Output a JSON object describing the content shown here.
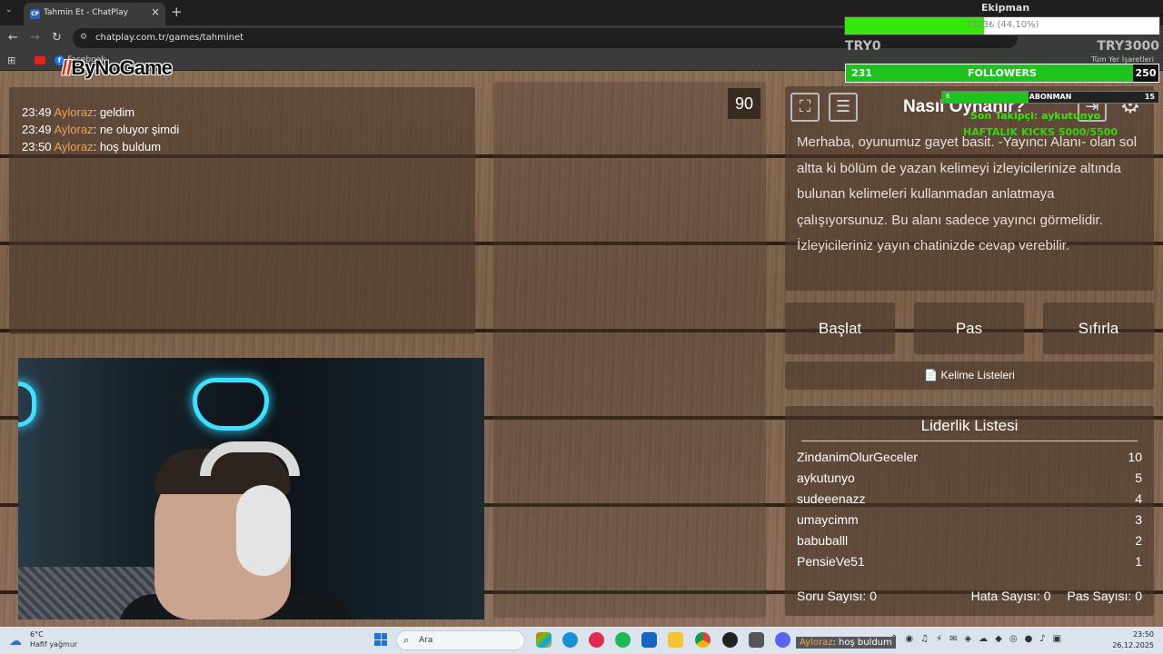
{
  "browser": {
    "tab_title": "Tahmin Et - ChatPlay",
    "tab_favicon": "CP",
    "url": "chatplay.com.tr/games/tahminet",
    "bookmark_facebook": "Facebook",
    "bookmark_all": "Tüm Yer İşaretleri"
  },
  "logo": {
    "mark": "//",
    "text": "ByNoGame"
  },
  "chat": {
    "messages": [
      {
        "time": "23:49",
        "user": "Ayloraz",
        "text": "geldim"
      },
      {
        "time": "23:49",
        "user": "Ayloraz",
        "text": "ne oluyor şimdi"
      },
      {
        "time": "23:50",
        "user": "Ayloraz",
        "text": "hoş buldum"
      }
    ]
  },
  "timer": "90",
  "howto": {
    "title": "Nasıl Oynanır?",
    "text": "Merhaba, oyunumuz gayet basit. -Yayıncı Alanı- olan sol altta ki bölüm de yazan kelimeyi izleyicilerinize altında bulunan kelimeleri kullanmadan anlatmaya çalışıyorsunuz. Bu alanı sadece yayıncı görmelidir. İzleyicileriniz yayın chatinizde cevap verebilir."
  },
  "buttons": {
    "start": "Başlat",
    "pass": "Pas",
    "reset": "Sıfırla",
    "word_lists": "📄 Kelime Listeleri"
  },
  "leaderboard": {
    "title": "Liderlik Listesi",
    "rows": [
      {
        "name": "ZindanimOlurGeceler",
        "score": "10"
      },
      {
        "name": "aykutunyo",
        "score": "5"
      },
      {
        "name": "sudeeenazz",
        "score": "4"
      },
      {
        "name": "umaycimm",
        "score": "3"
      },
      {
        "name": "babuballl",
        "score": "2"
      },
      {
        "name": "PensieVe51",
        "score": "1"
      }
    ],
    "question_count": "Soru Sayısı: 0",
    "error_count": "Hata Sayısı: 0",
    "pass_count": "Pas Sayısı: 0"
  },
  "overlay": {
    "equipment_label": "Ekipman",
    "equipment_progress_text": "1323₺ (44.10%)",
    "equipment_fraction": 0.441,
    "equipment_min": "TRY0",
    "equipment_max": "TRY3000",
    "followers_current": "231",
    "followers_label": "FOLLOWERS",
    "followers_goal": "250",
    "followers_fraction": 0.924,
    "sub_current": "6",
    "sub_label": "ABONMAN",
    "sub_goal": "15",
    "sub_fraction": 0.4,
    "last_follower": "Son Takipçi: aykutunyo",
    "weekly_kicks": "HAFTALIK KICKS 5000/5500"
  },
  "taskbar": {
    "temp": "6°C",
    "weather": "Hafif yağmur",
    "search": "Ara",
    "toast_user": "Ayloraz",
    "toast_text": ": hoş buldum",
    "time": "23:50",
    "date": "26.12.2025"
  },
  "colors": {
    "chat_name": "#e8a55a",
    "overlay_green": "#35e80b",
    "neon": "#3ee0ff"
  }
}
